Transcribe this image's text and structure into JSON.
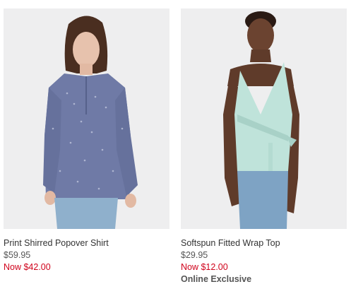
{
  "products": [
    {
      "name": "Print Shirred Popover Shirt",
      "original_price": "$59.95",
      "sale_price": "Now $42.00",
      "badge": ""
    },
    {
      "name": "Softspun Fitted Wrap Top",
      "original_price": "$29.95",
      "sale_price": "Now $12.00",
      "badge": "Online Exclusive"
    }
  ],
  "colors": {
    "photo_bg": "#eeeeef",
    "sale_red": "#d0021b",
    "text_gray": "#333333"
  }
}
